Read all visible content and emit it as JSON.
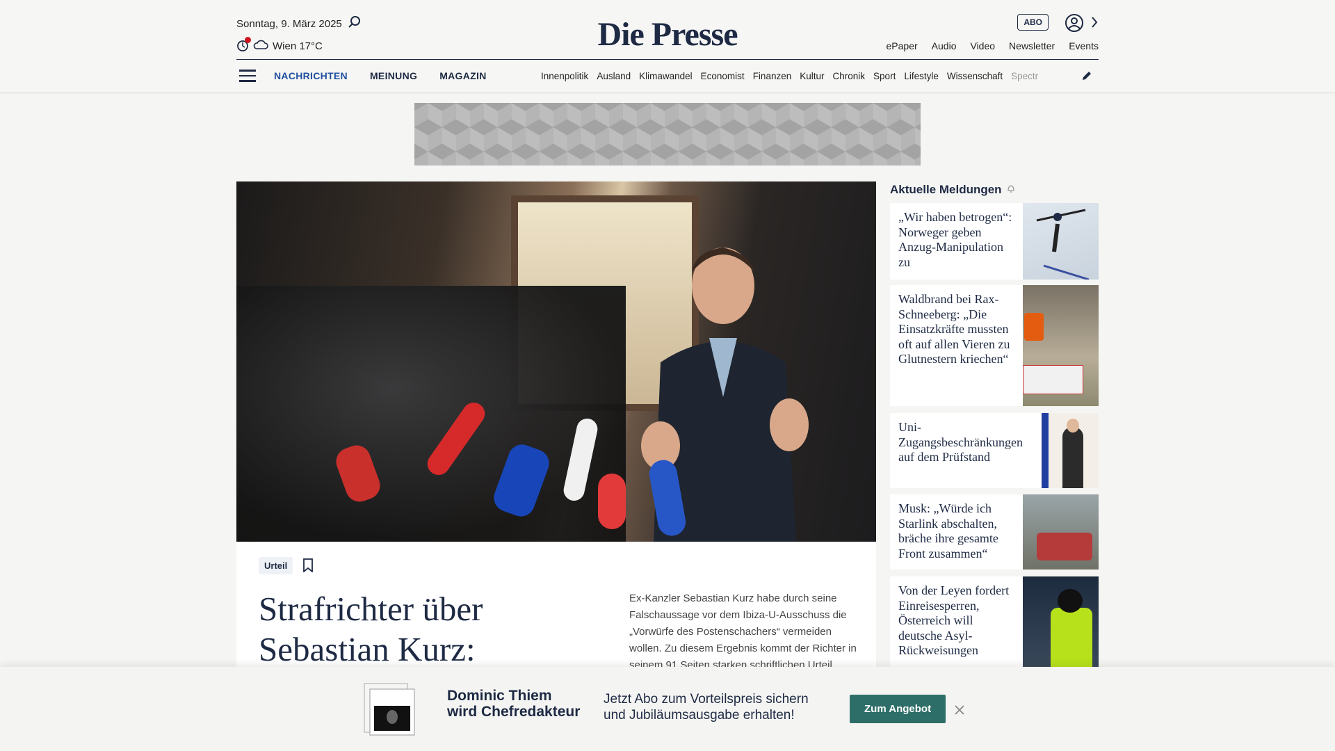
{
  "header": {
    "date": "Sonntag, 9. März 2025",
    "weather": "Wien 17°C",
    "logo": "Die Presse",
    "abo_label": "ABO",
    "links": [
      "ePaper",
      "Audio",
      "Video",
      "Newsletter",
      "Events"
    ]
  },
  "nav": {
    "main": [
      "NACHRICHTEN",
      "MEINUNG",
      "MAGAZIN"
    ],
    "sub": [
      "Innenpolitik",
      "Ausland",
      "Klimawandel",
      "Economist",
      "Finanzen",
      "Kultur",
      "Chronik",
      "Sport",
      "Lifestyle",
      "Wissenschaft",
      "Spectr"
    ]
  },
  "hero": {
    "tag": "Urteil",
    "headline": "Strafrichter über Sebastian Kurz:",
    "teaser": "Ex-Kanzler Sebastian Kurz habe durch seine Falschaussage vor dem Ibiza-U-Ausschuss die „Vorwürfe des Postenschachers“ vermeiden wollen. Zu diesem Ergebnis kommt der Richter in seinem 91 Seiten starken schriftlichen Urteil"
  },
  "sidebar": {
    "title": "Aktuelle Meldungen",
    "items": [
      {
        "text": "„Wir haben betrogen“: Norweger geben Anzug-Manipulation zu"
      },
      {
        "text": "Waldbrand bei Rax-Schneeberg: „Die Einsatzkräfte mussten oft auf allen Vieren zu Glutnestern kriechen“"
      },
      {
        "text": "Uni-Zugangsbeschränkungen auf dem Prüfstand"
      },
      {
        "text": "Musk: „Würde ich Starlink abschalten, bräche ihre gesamte Front zusammen“"
      },
      {
        "text": "Von der Leyen fordert Einreisesperren, Österreich will deutsche Asyl-Rückweisungen"
      }
    ]
  },
  "banner": {
    "title_line1": "Dominic Thiem",
    "title_line2": "wird Chefredakteur",
    "text_line1": "Jetzt Abo zum Vorteilspreis sichern",
    "text_line2": "und Jubiläumsausgabe erhalten!",
    "button": "Zum Angebot"
  },
  "colors": {
    "brand": "#1e2a44",
    "accent_nav": "#1f4fa0",
    "button": "#2e6e68"
  }
}
